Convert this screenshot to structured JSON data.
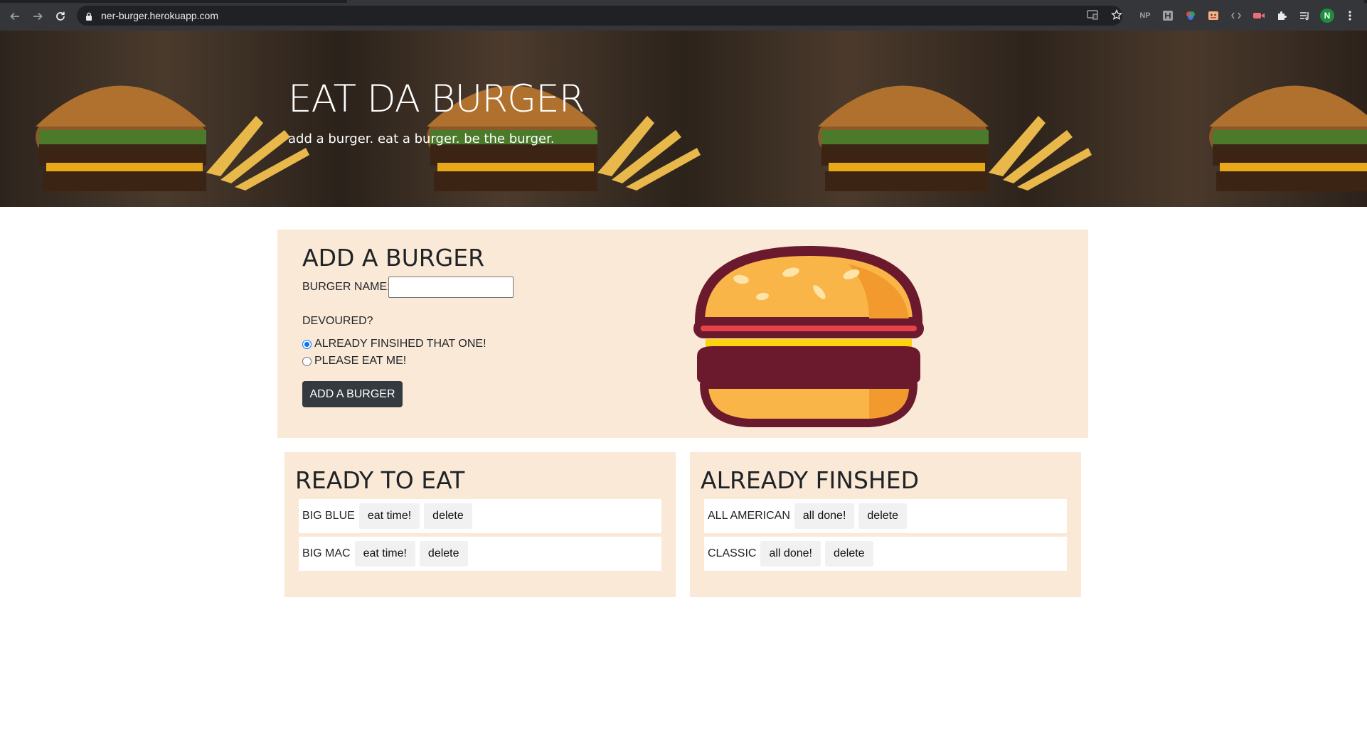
{
  "browser": {
    "url": "ner-burger.herokuapp.com",
    "extensions": [
      "NP"
    ],
    "profile_initial": "N"
  },
  "hero": {
    "title": "EAT DA BURGER",
    "tagline": "add a burger. eat a burger. be the burger."
  },
  "form": {
    "heading": "ADD A BURGER",
    "name_label": "BURGER NAME:",
    "name_value": "",
    "devoured_label": "DEVOURED?",
    "options": [
      {
        "label": "ALREADY FINSIHED THAT ONE!",
        "checked": true
      },
      {
        "label": "PLEASE EAT ME!",
        "checked": false
      }
    ],
    "submit_label": "ADD A BURGER"
  },
  "ready": {
    "heading": "READY TO EAT",
    "items": [
      {
        "name": "BIG BLUE",
        "action": "eat time!",
        "delete": "delete"
      },
      {
        "name": "BIG MAC",
        "action": "eat time!",
        "delete": "delete"
      }
    ]
  },
  "finished": {
    "heading": "ALREADY FINSHED",
    "items": [
      {
        "name": "ALL AMERICAN",
        "action": "all done!",
        "delete": "delete"
      },
      {
        "name": "CLASSIC",
        "action": "all done!",
        "delete": "delete"
      }
    ]
  },
  "colors": {
    "panel_bg": "#fae9d6",
    "button_dark": "#343a40",
    "burger_outline": "#6b1a2e",
    "bun": "#f9b548"
  }
}
